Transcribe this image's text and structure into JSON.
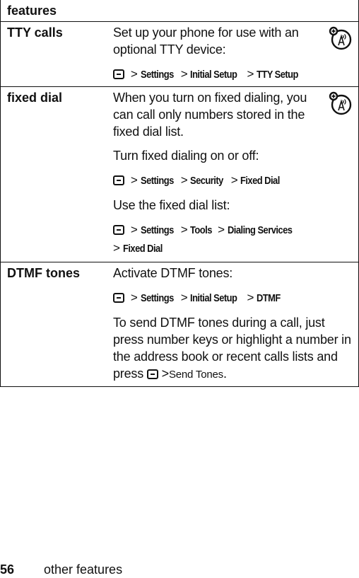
{
  "table": {
    "header": "features",
    "rows": [
      {
        "feature": "TTY calls",
        "network_icon": "network-dependent-feature-icon",
        "paragraphs": [
          "Set up your phone for use with an optional TTY device:"
        ],
        "paths": [
          {
            "icon": "menu-key-icon",
            "items": [
              "Settings",
              "Initial Setup",
              "TTY Setup"
            ]
          }
        ]
      },
      {
        "feature": "fixed dial",
        "network_icon": "network-dependent-feature-icon",
        "p1": "When you turn on fixed dialing, you can call only numbers stored in the fixed dial list.",
        "p2": "Turn fixed dialing on or off:",
        "path1": {
          "icon": "menu-key-icon",
          "items": [
            "Settings",
            "Security",
            "Fixed Dial"
          ]
        },
        "p3": "Use the fixed dial list:",
        "path2": {
          "icon": "menu-key-icon",
          "items": [
            "Settings",
            "Tools",
            "Dialing Services",
            "Fixed Dial"
          ]
        }
      },
      {
        "feature": "DTMF tones",
        "p1": "Activate DTMF tones:",
        "path1": {
          "icon": "menu-key-icon",
          "items": [
            "Settings",
            "Initial Setup",
            "DTMF"
          ]
        },
        "p2_prefix": "To send DTMF tones during a call, just press number keys or highlight a number in the address book or recent calls lists and press",
        "p2_path": {
          "icon": "menu-key-icon",
          "items": [
            "Send Tones"
          ]
        },
        "p2_suffix": "."
      }
    ]
  },
  "footer": {
    "page_number": "56",
    "section": "other features"
  },
  "separator": ">"
}
